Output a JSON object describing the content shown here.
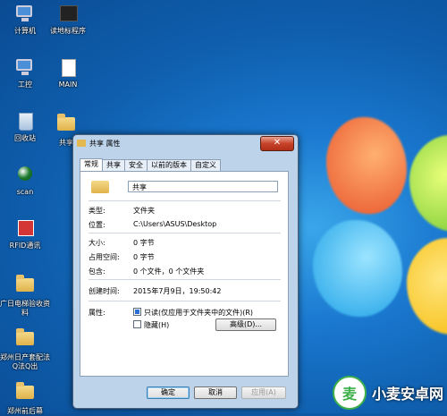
{
  "desktop": {
    "icons": [
      {
        "label": "计算机",
        "icon": "computer-icon"
      },
      {
        "label": "读地标程序",
        "icon": "program-icon"
      },
      {
        "label": "工控",
        "icon": "network-icon"
      },
      {
        "label": "MAIN",
        "icon": "document-icon"
      },
      {
        "label": "回收站",
        "icon": "recycle-bin-icon"
      },
      {
        "label": "共享",
        "icon": "folder-icon"
      },
      {
        "label": "scan",
        "icon": "scan-icon"
      },
      {
        "label": "RFID通讯",
        "icon": "rfid-icon"
      },
      {
        "label": "广日电梯验收资料",
        "icon": "folder-icon"
      },
      {
        "label": "郑州日产套配法Q法Q出",
        "icon": "folder-icon"
      },
      {
        "label": "郑州前后幕",
        "icon": "folder-icon"
      }
    ]
  },
  "dialog": {
    "title": "共享 属性",
    "close_label": "✕",
    "tabs": [
      "常规",
      "共享",
      "安全",
      "以前的版本",
      "自定义"
    ],
    "active_tab": "常规",
    "name_value": "共享",
    "props": [
      {
        "label": "类型:",
        "value": "文件夹"
      },
      {
        "label": "位置:",
        "value": "C:\\Users\\ASUS\\Desktop"
      },
      {
        "label": "大小:",
        "value": "0 字节"
      },
      {
        "label": "占用空间:",
        "value": "0 字节"
      },
      {
        "label": "包含:",
        "value": "0 个文件，0 个文件夹"
      },
      {
        "label": "创建时间:",
        "value": "2015年7月9日，19:50:42"
      }
    ],
    "attributes": {
      "label": "属性:",
      "readonly_label": "只读(仅应用于文件夹中的文件)(R)",
      "readonly_checked": true,
      "hidden_label": "隐藏(H)",
      "hidden_checked": false,
      "advanced_button": "高级(D)..."
    },
    "buttons": {
      "ok": "确定",
      "cancel": "取消",
      "apply": "应用(A)"
    }
  },
  "watermark": {
    "text": "小麦安卓网"
  },
  "colors": {
    "accent": "#2a6fd6",
    "titlebar": "#bcd3ea",
    "close": "#c7432a"
  }
}
